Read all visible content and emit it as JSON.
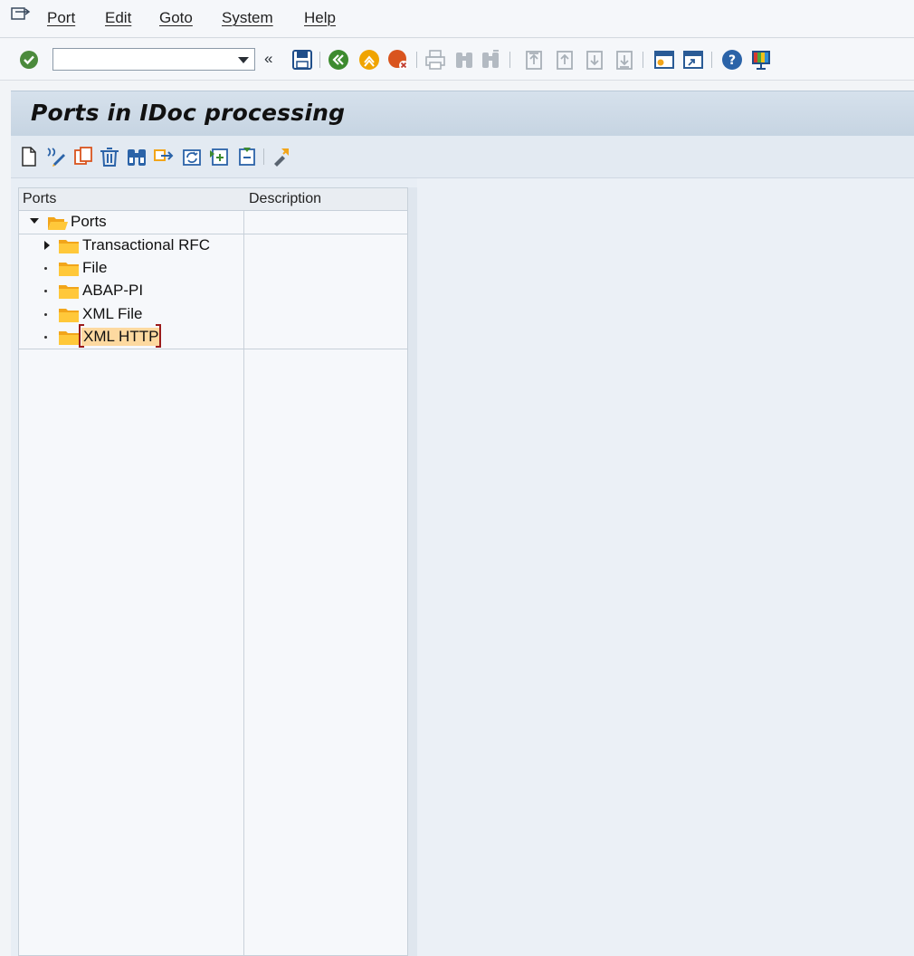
{
  "menubar": {
    "items": [
      "Port",
      "Edit",
      "Goto",
      "System",
      "Help"
    ]
  },
  "toolbar": {
    "command_field_value": "",
    "back_label": "«"
  },
  "title": "Ports in IDoc processing",
  "tree": {
    "columns": [
      "Ports",
      "Description"
    ],
    "root": "Ports",
    "children": [
      "Transactional RFC",
      "File",
      "ABAP-PI",
      "XML File",
      "XML HTTP"
    ]
  },
  "colors": {
    "accent_selected": "#fdd9a0",
    "folder": "#f7b500",
    "title_bar": "#cad7e5"
  }
}
